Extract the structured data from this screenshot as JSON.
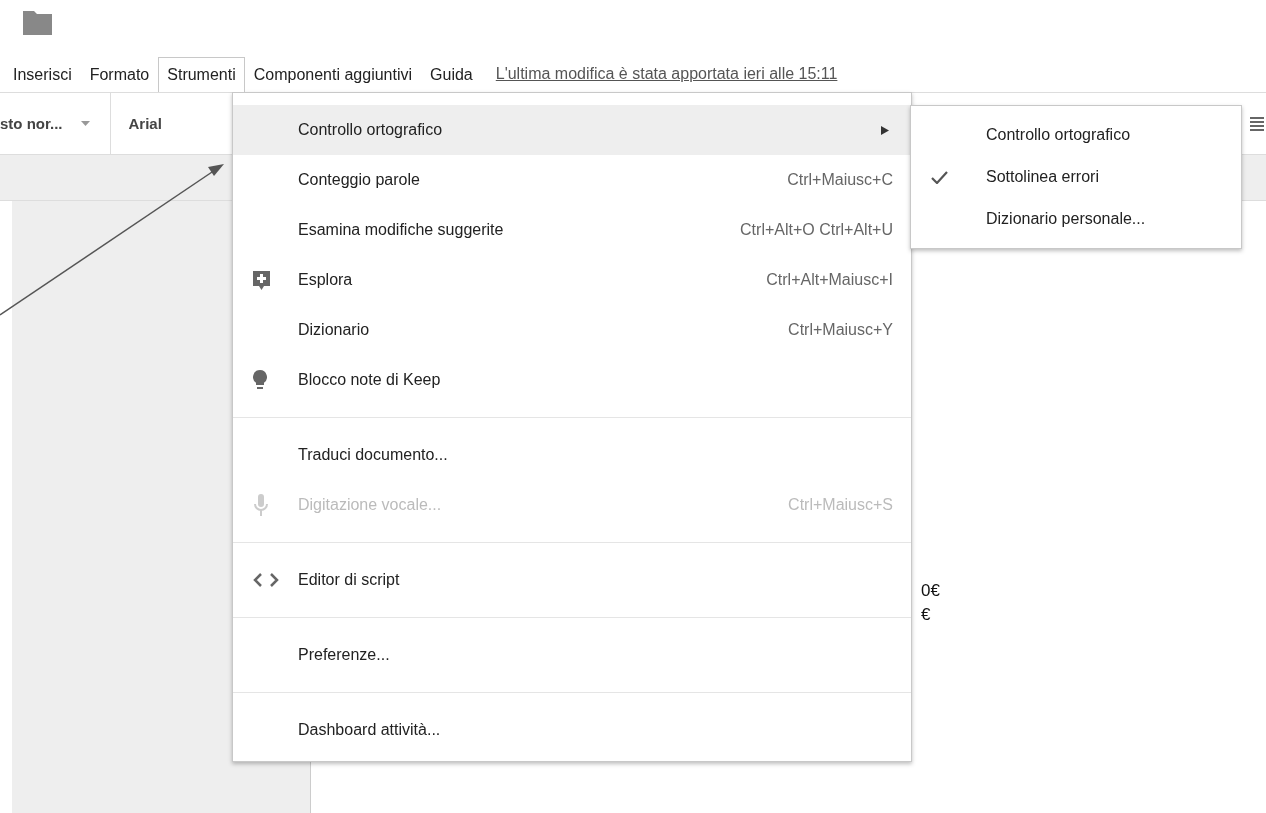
{
  "menubar": [
    {
      "label": "Inserisci",
      "selected": false
    },
    {
      "label": "Formato",
      "selected": false
    },
    {
      "label": "Strumenti",
      "selected": true
    },
    {
      "label": "Componenti aggiuntivi",
      "selected": false
    },
    {
      "label": "Guida",
      "selected": false
    }
  ],
  "last_edit": "L'ultima modifica è stata apportata ieri alle 15:11",
  "toolbar": {
    "style": "sto nor...",
    "font": "Arial"
  },
  "menu": {
    "items": [
      {
        "kind": "submenu",
        "label": "Controllo ortografico",
        "highlighted": true,
        "disabled": false
      },
      {
        "kind": "plain",
        "label": "Conteggio parole",
        "shortcut": "Ctrl+Maiusc+C",
        "highlighted": false,
        "disabled": false
      },
      {
        "kind": "plain",
        "label": "Esamina modifiche suggerite",
        "shortcut": "Ctrl+Alt+O Ctrl+Alt+U",
        "highlighted": false,
        "disabled": false
      },
      {
        "kind": "explore",
        "label": "Esplora",
        "shortcut": "Ctrl+Alt+Maiusc+I",
        "highlighted": false,
        "disabled": false
      },
      {
        "kind": "plain",
        "label": "Dizionario",
        "shortcut": "Ctrl+Maiusc+Y",
        "highlighted": false,
        "disabled": false
      },
      {
        "kind": "keep",
        "label": "Blocco note di Keep",
        "highlighted": false,
        "disabled": false
      },
      {
        "kind": "divider"
      },
      {
        "kind": "plain",
        "label": "Traduci documento...",
        "highlighted": false,
        "disabled": false
      },
      {
        "kind": "voice",
        "label": "Digitazione vocale...",
        "shortcut": "Ctrl+Maiusc+S",
        "highlighted": false,
        "disabled": true
      },
      {
        "kind": "divider"
      },
      {
        "kind": "script",
        "label": "Editor di script",
        "highlighted": false,
        "disabled": false
      },
      {
        "kind": "divider"
      },
      {
        "kind": "plain",
        "label": "Preferenze...",
        "highlighted": false,
        "disabled": false
      },
      {
        "kind": "divider"
      },
      {
        "kind": "plain",
        "label": "Dashboard attività...",
        "highlighted": false,
        "disabled": false
      }
    ]
  },
  "submenu": {
    "items": [
      {
        "label": "Controllo ortografico",
        "checked": false
      },
      {
        "label": "Sottolinea errori",
        "checked": true
      },
      {
        "label": "Dizionario personale...",
        "checked": false
      }
    ]
  },
  "document": {
    "lines": [
      "0€",
      "€"
    ]
  }
}
